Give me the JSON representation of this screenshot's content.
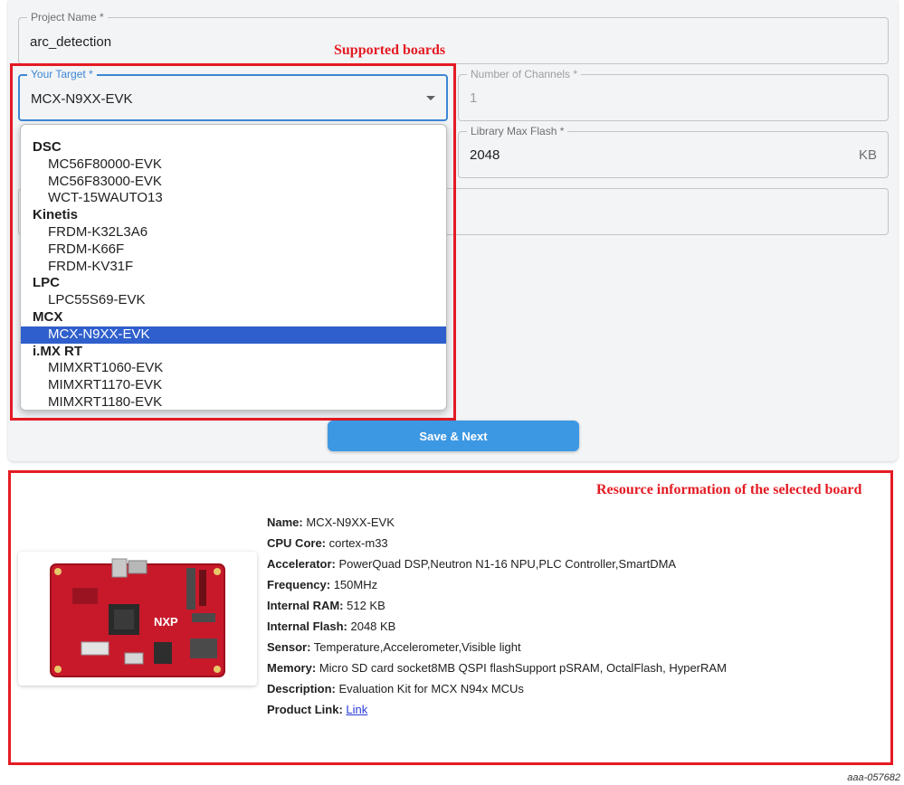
{
  "form": {
    "project_name": {
      "label": "Project Name *",
      "value": "arc_detection"
    },
    "target": {
      "label": "Your Target *",
      "value": "MCX-N9XX-EVK"
    },
    "channels": {
      "label": "Number of Channels *",
      "value": "1"
    },
    "max_flash": {
      "label": "Library Max Flash *",
      "value": "2048",
      "unit": "KB"
    },
    "save_button": "Save & Next"
  },
  "annotations": {
    "supported_boards": "Supported boards",
    "resource_info": "Resource information of the selected board"
  },
  "dropdown": {
    "groups": [
      {
        "name": "DSC",
        "items": [
          "MC56F80000-EVK",
          "MC56F83000-EVK",
          "WCT-15WAUTO13"
        ]
      },
      {
        "name": "Kinetis",
        "items": [
          "FRDM-K32L3A6",
          "FRDM-K66F",
          "FRDM-KV31F"
        ]
      },
      {
        "name": "LPC",
        "items": [
          "LPC55S69-EVK"
        ]
      },
      {
        "name": "MCX",
        "items": [
          "MCX-N9XX-EVK"
        ]
      },
      {
        "name": "i.MX RT",
        "items": [
          "MIMXRT1060-EVK",
          "MIMXRT1170-EVK",
          "MIMXRT1180-EVK"
        ]
      }
    ],
    "selected": "MCX-N9XX-EVK"
  },
  "board": {
    "image_logo": "NXP",
    "fields": [
      {
        "key": "Name:",
        "value": "MCX-N9XX-EVK"
      },
      {
        "key": "CPU Core:",
        "value": "cortex-m33"
      },
      {
        "key": "Accelerator:",
        "value": "PowerQuad DSP,Neutron N1-16 NPU,PLC Controller,SmartDMA"
      },
      {
        "key": "Frequency:",
        "value": "150MHz"
      },
      {
        "key": "Internal RAM:",
        "value": "512 KB"
      },
      {
        "key": "Internal Flash:",
        "value": "2048 KB"
      },
      {
        "key": "Sensor:",
        "value": "Temperature,Accelerometer,Visible light"
      },
      {
        "key": "Memory:",
        "value": "Micro SD card socket8MB QSPI flashSupport pSRAM, OctalFlash, HyperRAM"
      },
      {
        "key": "Description:",
        "value": "Evaluation Kit for MCX N94x MCUs"
      }
    ],
    "product_link": {
      "key": "Product Link:",
      "text": "Link"
    }
  },
  "figure_id": "aaa-057682",
  "colors": {
    "annotation": "#e41b23",
    "accent": "#3d86d4",
    "selected": "#2f5fcc",
    "button": "#3d98e3"
  }
}
